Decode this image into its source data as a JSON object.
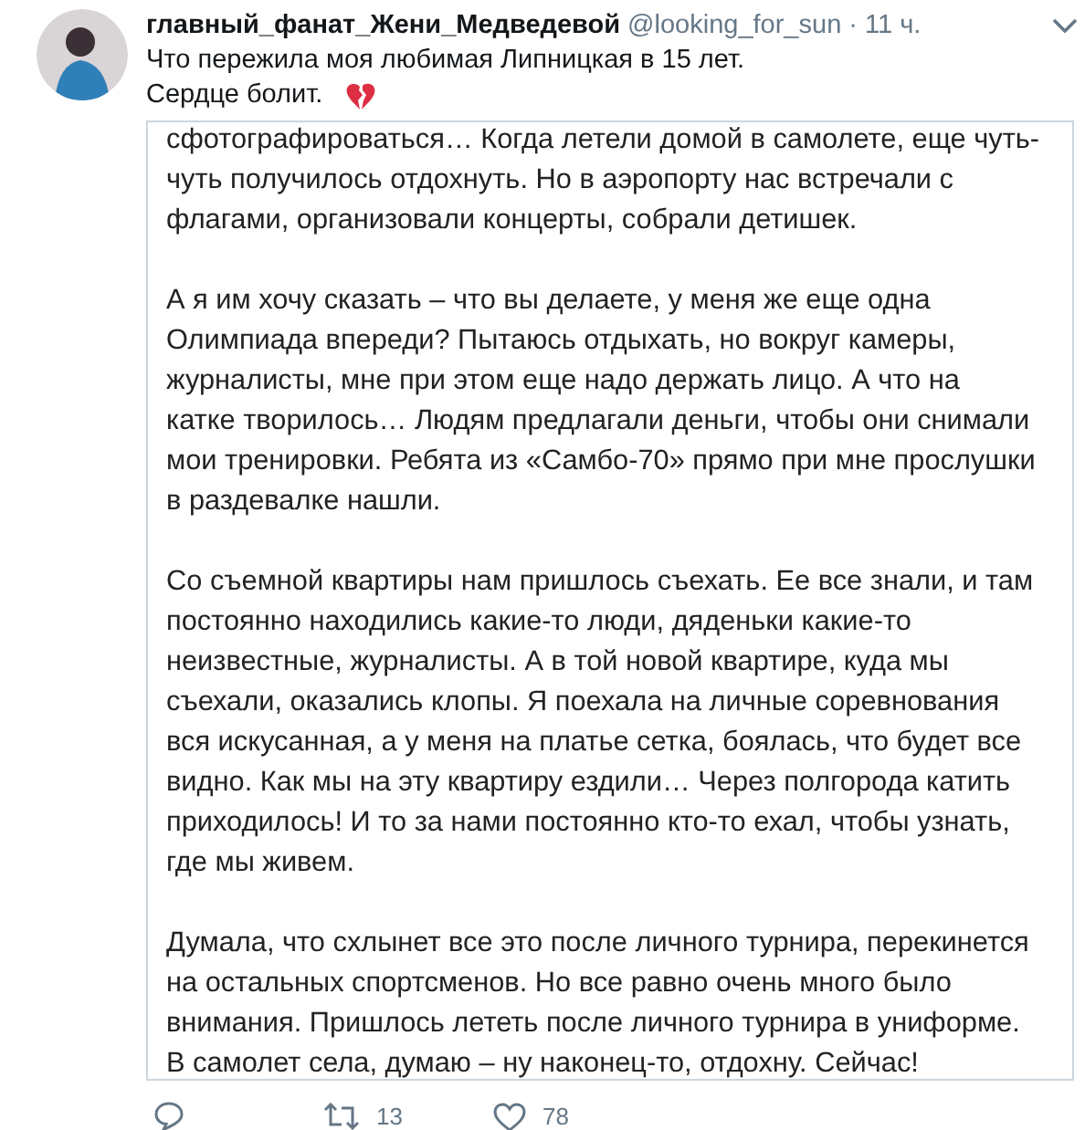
{
  "tweet": {
    "display_name": "главный_фанат_Жени_Медведевой",
    "handle": "@looking_for_sun",
    "separator": "·",
    "time": "11 ч.",
    "text_lines": [
      "Что пережила моя любимая Липницкая в 15 лет.",
      "Сердце болит."
    ],
    "attached_text": [
      [
        "сфотографироваться… Когда летели домой в самолете, еще чуть-",
        "чуть получилось отдохнуть. Но в аэропорту нас встречали с",
        "флагами, организовали концерты, собрали детишек."
      ],
      [
        "А я им хочу сказать – что вы делаете, у меня же еще одна",
        "Олимпиада впереди? Пытаюсь отдыхать, но вокруг камеры,",
        "журналисты, мне при этом еще надо держать лицо. А что на",
        "катке творилось… Людям предлагали деньги, чтобы они снимали",
        "мои тренировки. Ребята из «Самбо-70» прямо при мне прослушки",
        "в раздевалке нашли."
      ],
      [
        "Со съемной квартиры нам пришлось съехать. Ее все знали, и там",
        "постоянно находились какие-то люди, дяденьки какие-то",
        "неизвестные, журналисты. А в той новой квартире, куда мы",
        "съехали, оказались клопы. Я поехала на личные соревнования",
        "вся искусанная, а у меня на платье сетка, боялась, что будет все",
        "видно. Как мы на эту квартиру ездили… Через полгорода катить",
        "приходилось! И то за нами постоянно кто-то ехал, чтобы узнать,",
        "где мы живем."
      ],
      [
        "Думала, что схлынет все это после личного турнира, перекинется",
        "на остальных спортсменов. Но все равно очень много было",
        "внимания. Пришлось лететь после личного турнира в униформе.",
        "В самолет села, думаю – ну наконец-то, отдохну. Сейчас!"
      ]
    ],
    "actions": [
      {
        "kind": "reply"
      },
      {
        "kind": "retweet",
        "count": "13"
      },
      {
        "kind": "like",
        "count": "78"
      }
    ]
  }
}
